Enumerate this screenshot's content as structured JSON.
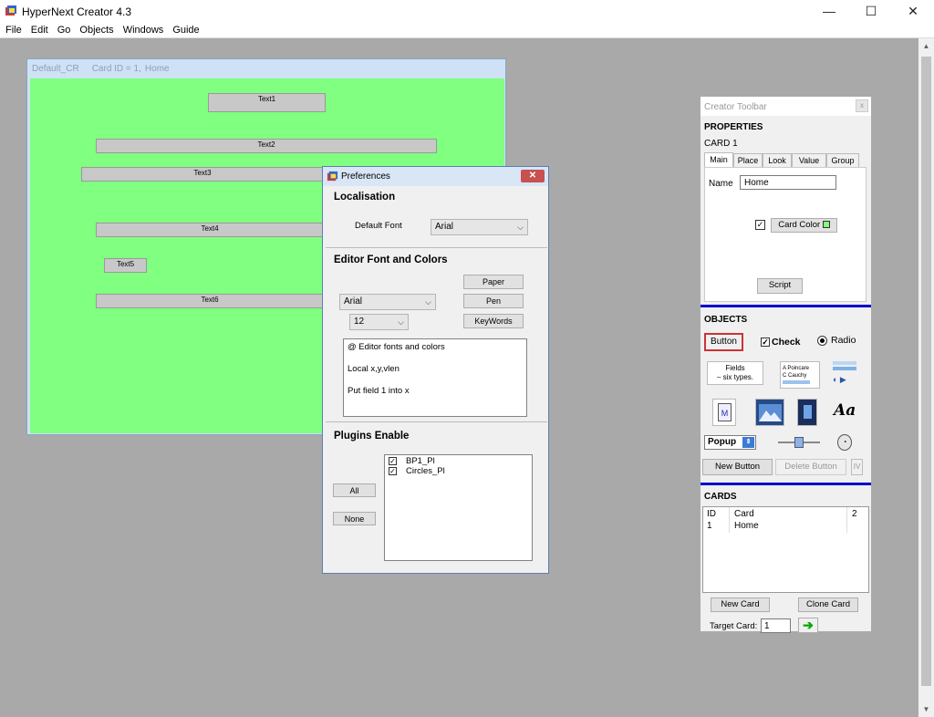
{
  "app": {
    "title": "HyperNext Creator 4.3",
    "controls": {
      "minimize": "—",
      "maximize": "☐",
      "close": "✕"
    }
  },
  "menu": [
    "File",
    "Edit",
    "Go",
    "Objects",
    "Windows",
    "Guide"
  ],
  "card_window": {
    "title_name": "Default_CR",
    "title_id": "Card ID = 1,",
    "title_card": "Home",
    "background_color": "#80ff80",
    "fields": [
      "Text1",
      "Text2",
      "Text3",
      "Text4",
      "Text5",
      "Text6"
    ]
  },
  "preferences": {
    "title": "Preferences",
    "close": "✕",
    "localisation": {
      "heading": "Localisation",
      "default_font_label": "Default Font",
      "default_font_value": "Arial"
    },
    "editor": {
      "heading": "Editor Font and Colors",
      "font_value": "Arial",
      "size_value": "12",
      "paper": "Paper",
      "pen": "Pen",
      "keywords": "KeyWords",
      "preview_lines": [
        "@ Editor fonts and colors",
        "Local x,y,vlen",
        "Put field 1 into x"
      ]
    },
    "plugins": {
      "heading": "Plugins Enable",
      "all": "All",
      "none": "None",
      "items": [
        {
          "name": "BP1_Pl",
          "checked": true
        },
        {
          "name": "Circles_Pl",
          "checked": true
        }
      ]
    }
  },
  "toolbar": {
    "title": "Creator Toolbar",
    "close": "x",
    "properties_heading": "PROPERTIES",
    "card_label": "CARD 1",
    "tabs": [
      "Main",
      "Place",
      "Look",
      "Value",
      "Group"
    ],
    "name_label": "Name",
    "name_value": "Home",
    "card_color_label": "Card Color",
    "card_color": "#80ff80",
    "script_label": "Script",
    "objects_heading": "OBJECTS",
    "obj_button": "Button",
    "obj_check": "Check",
    "obj_radio": "Radio",
    "fields_line1": "Fields",
    "fields_line2": "– six types.",
    "list_row1": "A  Poincare",
    "list_row2": "C  Cauchy",
    "font_icon_text": "Aa",
    "movie_icon_text": "M",
    "popup_label": "Popup",
    "new_button": "New Button",
    "delete_button": "Delete Button",
    "iv_label": "IV",
    "cards_heading": "CARDS",
    "cards_table": {
      "headers": [
        "ID",
        "Card",
        "2"
      ],
      "rows": [
        [
          "1",
          "Home"
        ]
      ]
    },
    "new_card": "New Card",
    "clone_card": "Clone Card",
    "target_card_label": "Target Card:",
    "target_card_value": "1",
    "go_arrow": "➔"
  }
}
